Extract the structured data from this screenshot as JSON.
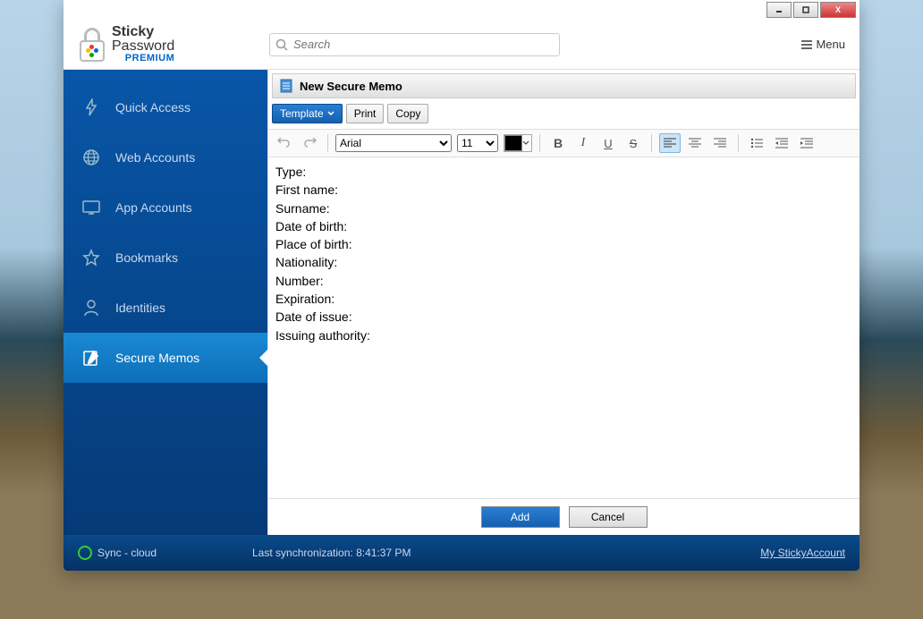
{
  "app": {
    "logo": {
      "line1": "Sticky",
      "line2": "Password",
      "line3": "PREMIUM"
    }
  },
  "header": {
    "search_placeholder": "Search",
    "menu_label": "Menu"
  },
  "sidebar": {
    "items": [
      {
        "label": "Quick Access"
      },
      {
        "label": "Web Accounts"
      },
      {
        "label": "App Accounts"
      },
      {
        "label": "Bookmarks"
      },
      {
        "label": "Identities"
      },
      {
        "label": "Secure Memos"
      }
    ],
    "active_index": 5
  },
  "panel": {
    "title": "New Secure Memo",
    "toolbar1": {
      "template": "Template",
      "print": "Print",
      "copy": "Copy"
    },
    "toolbar2": {
      "fonts": [
        "Arial"
      ],
      "font_value": "Arial",
      "sizes": [
        "11"
      ],
      "size_value": "11",
      "color": "#000000"
    },
    "editor_lines": [
      "Type:",
      "First name:",
      "Surname:",
      "Date of birth:",
      "Place of birth:",
      "Nationality:",
      "Number:",
      "Expiration:",
      "Date of issue:",
      "Issuing authority:"
    ],
    "buttons": {
      "add": "Add",
      "cancel": "Cancel"
    }
  },
  "status": {
    "sync_label": "Sync - cloud",
    "last_sync": "Last synchronization: 8:41:37 PM",
    "account_link": "My StickyAccount"
  }
}
